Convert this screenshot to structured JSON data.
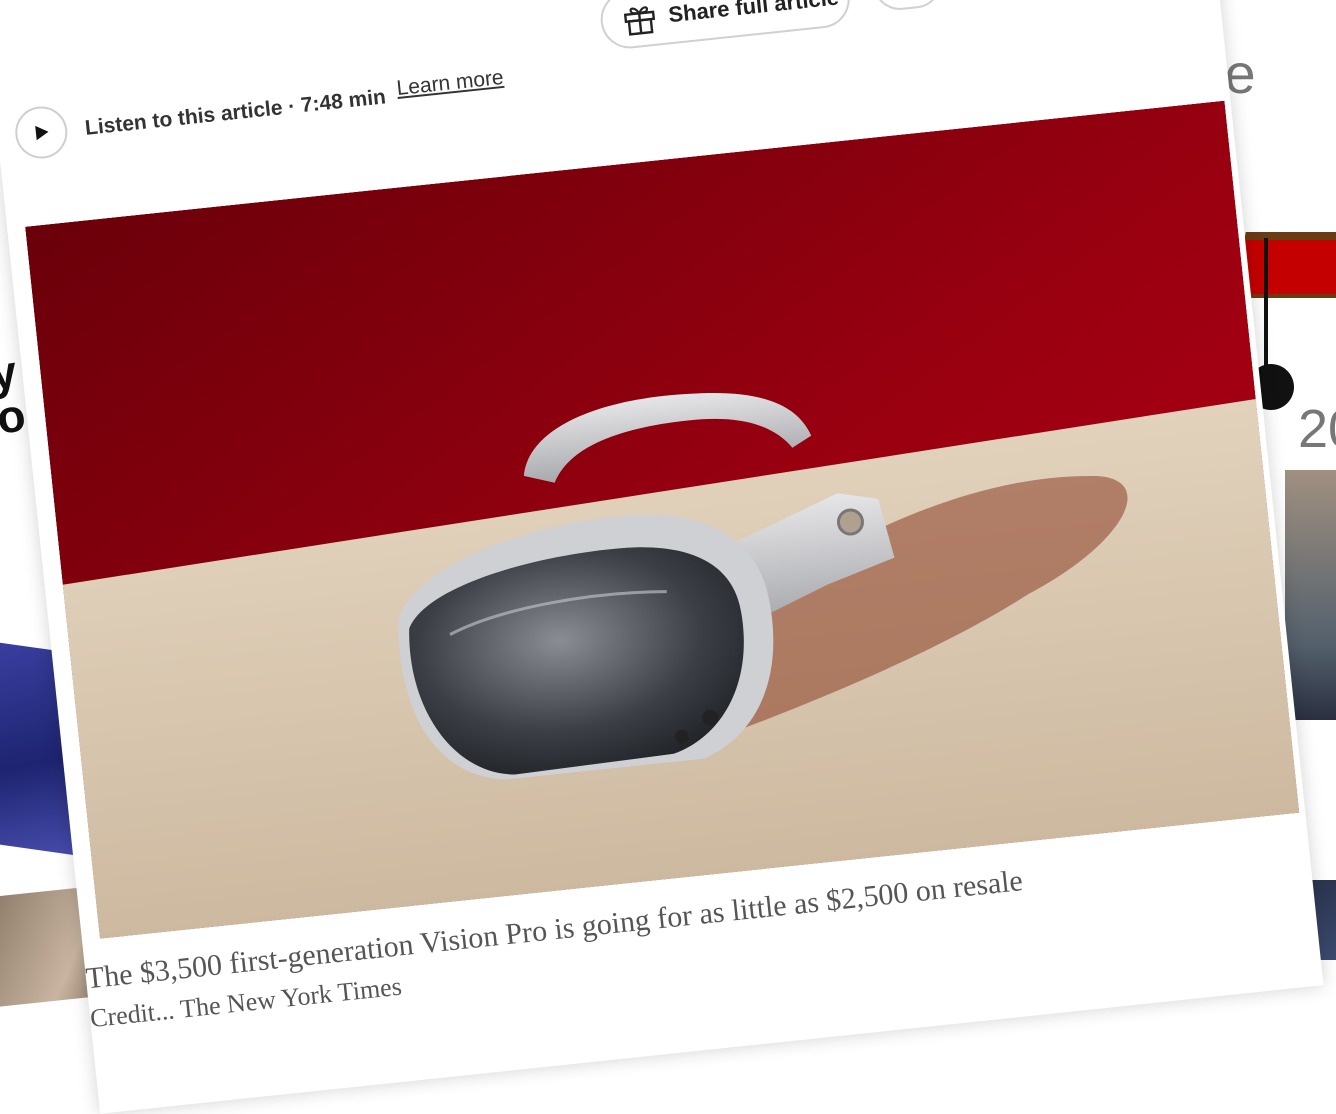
{
  "audio": {
    "listen_label": "Listen to this article · 7:48 min",
    "learn_more": "Learn more"
  },
  "share": {
    "label": "Share full article"
  },
  "hero_image": {
    "caption": "The $3,500 first-generation Vision Pro is going for as little as $2,500 on resale",
    "credit": "Credit... The New York Times"
  },
  "background": {
    "fragment_le": "le",
    "fragment_20": "20"
  },
  "colors": {
    "backdrop_red": "#9a0010",
    "table_beige": "#d9c7b0",
    "highlight_yellow": "#fff200"
  },
  "icons": [
    "play-icon",
    "gift-icon"
  ]
}
